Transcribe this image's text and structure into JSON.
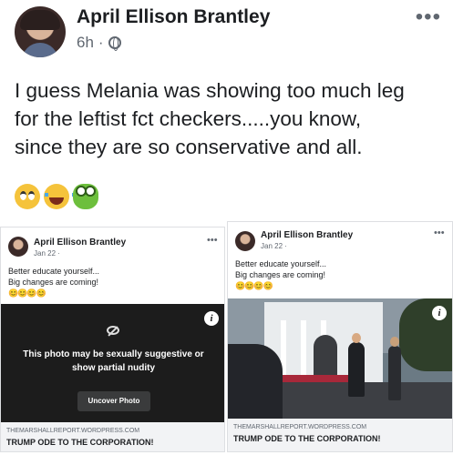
{
  "post": {
    "author": "April Ellison Brantley",
    "time": "6h",
    "separator": "·",
    "more": "•••",
    "text_lines": [
      "I guess Melania was showing too much leg",
      "for the leftist fct checkers.....you know,",
      "since they are so conservative and all."
    ],
    "reactions": [
      "face-with-rolling-eyes",
      "face-with-tears-of-joy",
      "frog-face"
    ]
  },
  "shared_left": {
    "author": "April Ellison Brantley",
    "time": "Jan 22 ·",
    "more": "•••",
    "text_line1": "Better educate yourself...",
    "text_line2": "Big changes are coming!",
    "emoji": "😊😊😊😊",
    "warning": "This photo may be sexually suggestive or show partial nudity",
    "uncover_label": "Uncover Photo",
    "info": "i",
    "link_domain": "THEMARSHALLREPORT.WORDPRESS.COM",
    "link_title": "TRUMP ODE TO THE CORPORATION!"
  },
  "shared_right": {
    "author": "April Ellison Brantley",
    "time": "Jan 22 ·",
    "more": "•••",
    "text_line1": "Better educate yourself...",
    "text_line2": "Big changes are coming!",
    "emoji": "😊😊😊😊",
    "info": "i",
    "link_domain": "THEMARSHALLREPORT.WORDPRESS.COM",
    "link_title": "TRUMP ODE TO THE CORPORATION!"
  }
}
